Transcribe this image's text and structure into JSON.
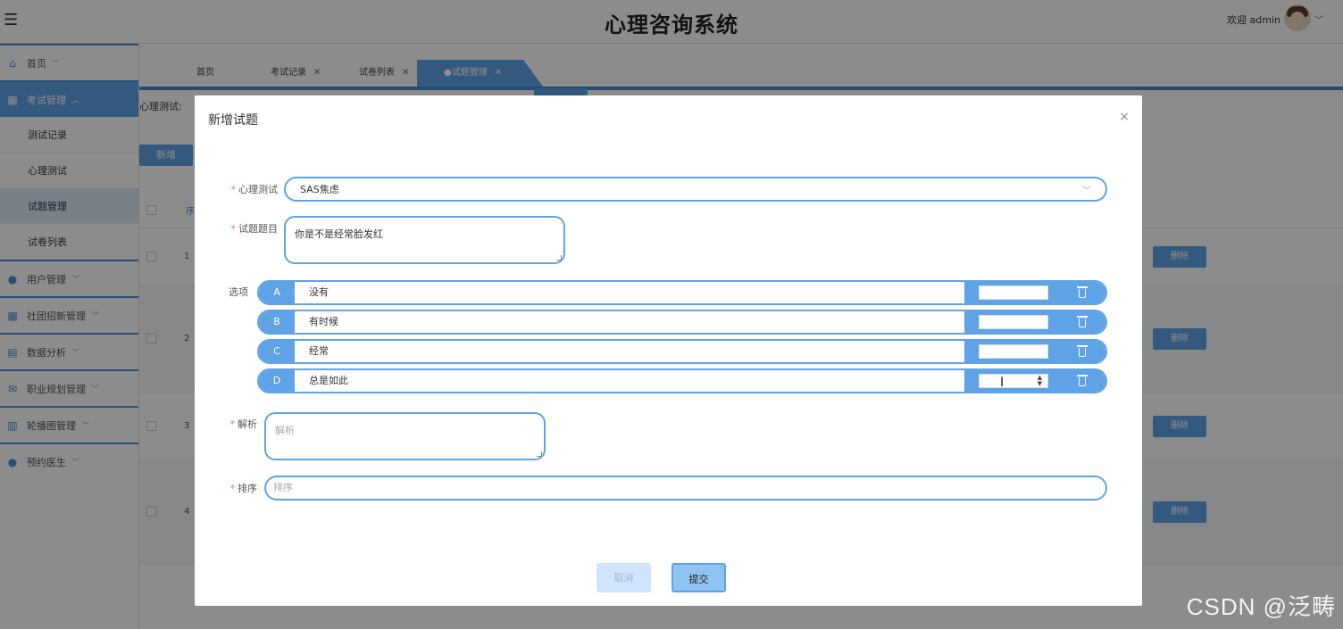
{
  "header": {
    "title": "心理咨询系统",
    "welcome": "欢迎 admin"
  },
  "sidebar": {
    "items": [
      {
        "label": "首页",
        "icon": "home-icon"
      },
      {
        "label": "考试管理",
        "icon": "apps-icon",
        "active": true,
        "children": [
          {
            "label": "测试记录"
          },
          {
            "label": "心理测试"
          },
          {
            "label": "试题管理",
            "active": true
          },
          {
            "label": "试卷列表"
          }
        ]
      },
      {
        "label": "用户管理",
        "icon": "user-icon"
      },
      {
        "label": "社团招新管理",
        "icon": "apps-icon"
      },
      {
        "label": "数据分析",
        "icon": "list-icon"
      },
      {
        "label": "职业规划管理",
        "icon": "mail-icon"
      },
      {
        "label": "轮播图管理",
        "icon": "columns-icon"
      },
      {
        "label": "预约医生",
        "icon": "user-icon"
      }
    ]
  },
  "tabs": [
    {
      "label": "首页"
    },
    {
      "label": "考试记录"
    },
    {
      "label": "试卷列表"
    },
    {
      "label": "●试题管理",
      "active": true
    }
  ],
  "background": {
    "filter_label": "心理测试:",
    "add_button": "新增",
    "header_num": "序",
    "rows": [
      {
        "num": "1",
        "delete": "删除"
      },
      {
        "num": "2",
        "delete": "删除"
      },
      {
        "num": "3",
        "delete": "删除"
      },
      {
        "num": "4",
        "delete": "删除"
      }
    ]
  },
  "dialog": {
    "title": "新增试题",
    "close_symbol": "×",
    "test_label": "心理测试",
    "test_value": "SAS焦虑",
    "question_label": "试题题目",
    "question_value": "你是不是经常脸发红",
    "options_label": "选项",
    "options": [
      {
        "letter": "A",
        "text": "没有"
      },
      {
        "letter": "B",
        "text": "有时候"
      },
      {
        "letter": "C",
        "text": "经常"
      },
      {
        "letter": "D",
        "text": "总是如此"
      }
    ],
    "analysis_label": "解析",
    "analysis_placeholder": "解析",
    "order_label": "排序",
    "order_placeholder": "排序",
    "cancel": "取消",
    "submit": "提交"
  },
  "watermark": "CSDN @泛畴",
  "colors": {
    "accent": "#5ea3e6",
    "accent_dark": "#3d8bd9",
    "required": "#f56c6c"
  }
}
